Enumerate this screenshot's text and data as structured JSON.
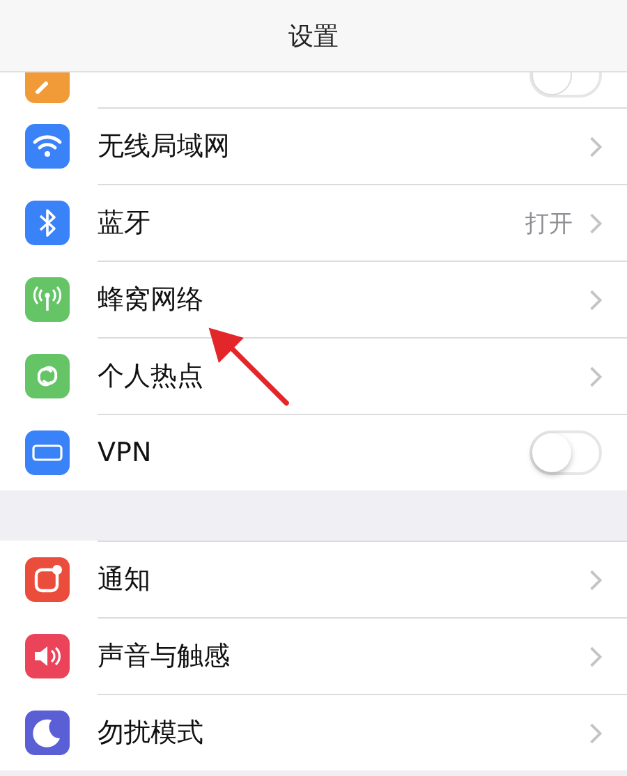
{
  "header": {
    "title": "设置"
  },
  "sections": [
    {
      "items": [
        {
          "kind": "switch",
          "on": false,
          "color": "#f19a38"
        },
        {
          "label": "无线局域网",
          "kind": "link",
          "color": "#3a82f7"
        },
        {
          "label": "蓝牙",
          "kind": "link",
          "value": "打开",
          "color": "#3a82f7"
        },
        {
          "label": "蜂窝网络",
          "kind": "link",
          "color": "#65c466"
        },
        {
          "label": "个人热点",
          "kind": "link",
          "color": "#65c466"
        },
        {
          "label": "VPN",
          "kind": "switch",
          "on": false,
          "color": "#3a82f7"
        }
      ]
    },
    {
      "items": [
        {
          "label": "通知",
          "kind": "link",
          "color": "#eb4d3d"
        },
        {
          "label": "声音与触感",
          "kind": "link",
          "color": "#eb445a"
        },
        {
          "label": "勿扰模式",
          "kind": "link",
          "color": "#5b5fd6"
        }
      ]
    }
  ]
}
